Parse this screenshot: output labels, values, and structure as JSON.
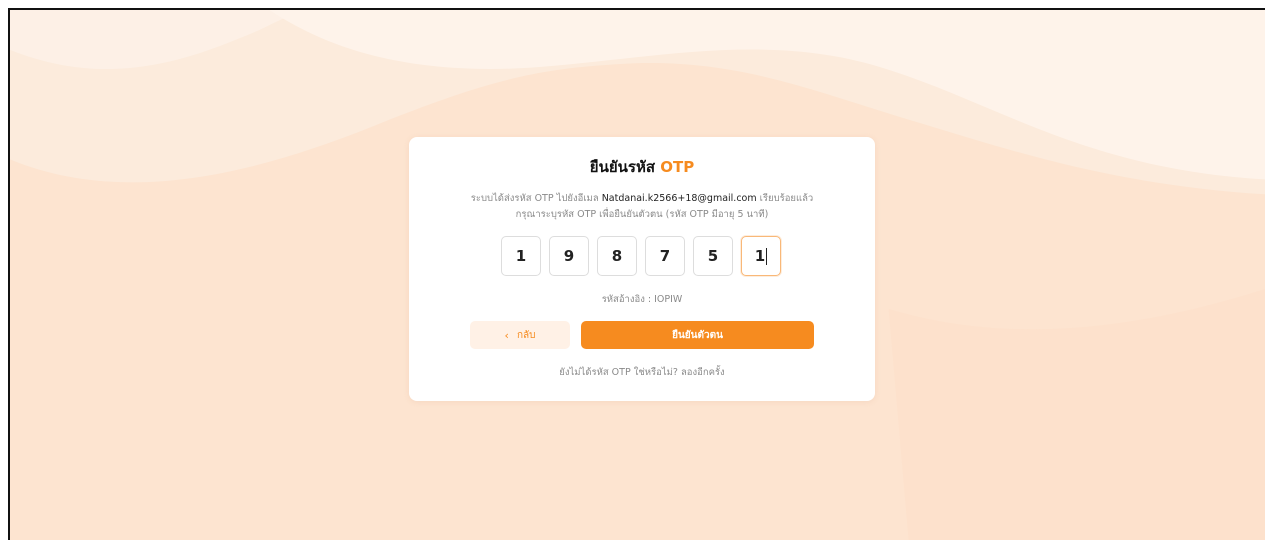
{
  "colors": {
    "accent": "#f68b1f",
    "background_peach": "#fde3cf",
    "background_light": "#fdf4ec",
    "back_button_bg": "#fff1e6"
  },
  "otp_card": {
    "title_prefix": "ยืนยันรหัส",
    "title_accent": "OTP",
    "desc_line1_pre": "ระบบได้ส่งรหัส OTP ไปยังอีเมล",
    "email": "Natdanai.k2566+18@gmail.com",
    "desc_line1_post": "เรียบร้อยแล้ว",
    "desc_line2": "กรุณาระบุรหัส OTP เพื่อยืนยันตัวตน (รหัส OTP มีอายุ 5 นาที)",
    "digits": [
      "1",
      "9",
      "8",
      "7",
      "5",
      "1"
    ],
    "reference_label": "รหัสอ้างอิง :",
    "reference_code": "IOPIW",
    "back_icon": "chevron-left-icon",
    "back_label": "กลับ",
    "confirm_label": "ยืนยันตัวตน",
    "resend_prompt": "ยังไม่ได้รหัส OTP ใช่หรือไม่?",
    "resend_link": "ลองอีกครั้ง"
  }
}
